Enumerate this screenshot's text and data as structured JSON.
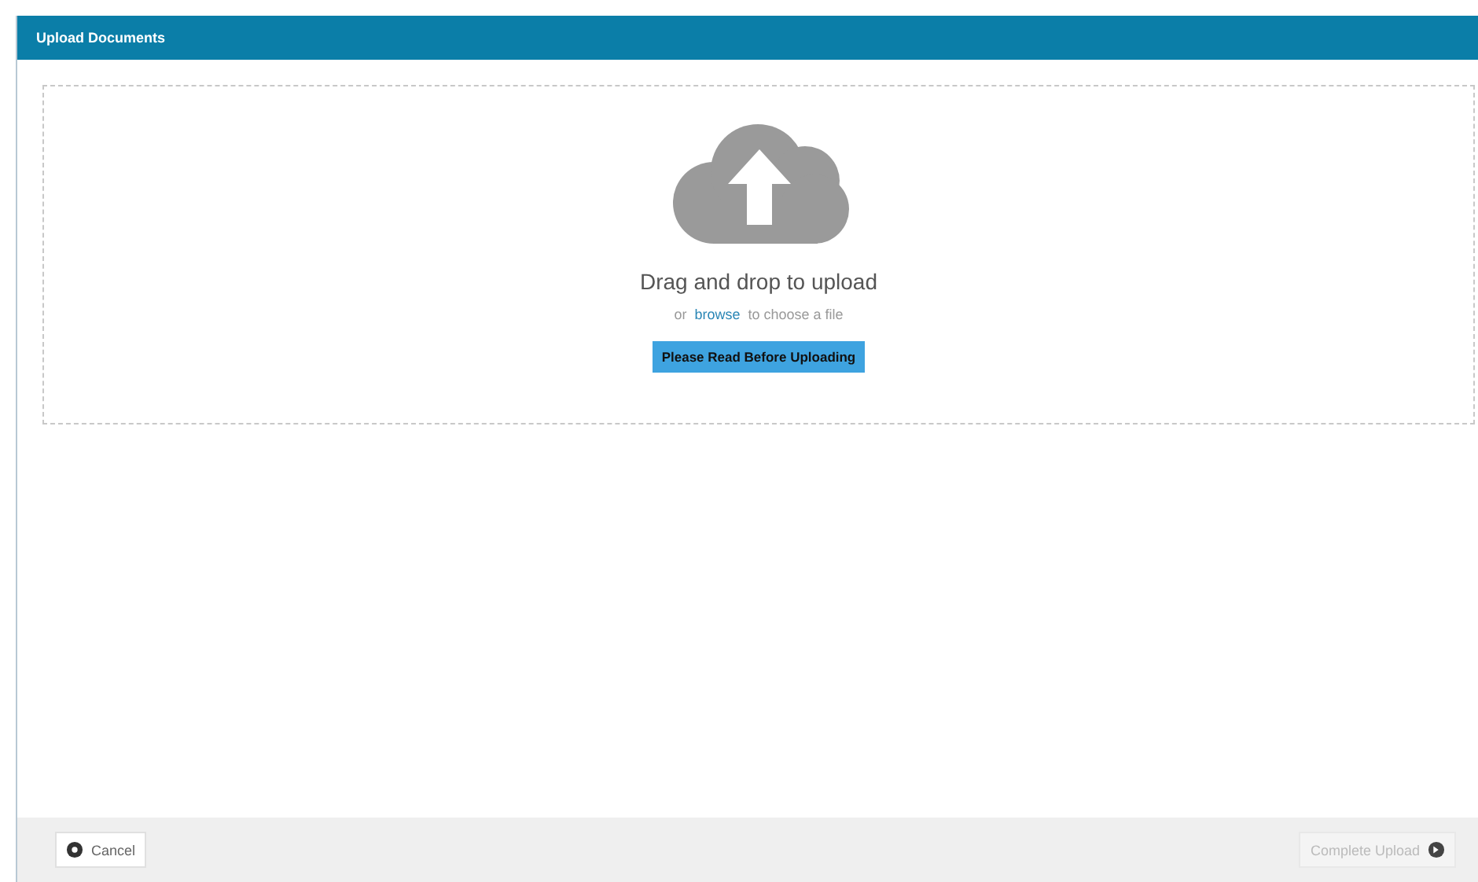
{
  "window": {
    "title": "Upload Documents"
  },
  "dropzone": {
    "heading": "Drag and drop to upload",
    "prefix": "or",
    "link": "browse",
    "suffix": "to choose a file",
    "notice_button": "Please Read Before Uploading"
  },
  "footer": {
    "cancel": {
      "label": "Cancel",
      "disabled": false
    },
    "complete": {
      "label": "Complete Upload",
      "disabled": true
    }
  }
}
